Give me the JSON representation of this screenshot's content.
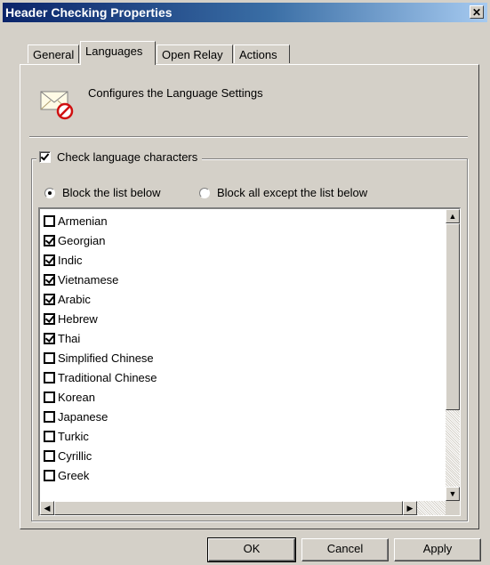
{
  "window": {
    "title": "Header Checking Properties",
    "close_glyph": "✕"
  },
  "tabs": [
    {
      "label": "General"
    },
    {
      "label": "Languages"
    },
    {
      "label": "Open Relay"
    },
    {
      "label": "Actions"
    }
  ],
  "active_tab": "Languages",
  "header": {
    "icon": "envelope-no-icon",
    "description": "Configures the Language Settings"
  },
  "check_language": {
    "label": "Check language characters",
    "checked": true
  },
  "mode": {
    "options": [
      {
        "label": "Block the list below",
        "selected": true
      },
      {
        "label": "Block all except the list below",
        "selected": false
      }
    ]
  },
  "languages": [
    {
      "label": "Armenian",
      "checked": false
    },
    {
      "label": "Georgian",
      "checked": true
    },
    {
      "label": "Indic",
      "checked": true
    },
    {
      "label": "Vietnamese",
      "checked": true
    },
    {
      "label": "Arabic",
      "checked": true
    },
    {
      "label": "Hebrew",
      "checked": true
    },
    {
      "label": "Thai",
      "checked": true
    },
    {
      "label": "Simplified Chinese",
      "checked": false
    },
    {
      "label": "Traditional Chinese",
      "checked": false
    },
    {
      "label": "Korean",
      "checked": false
    },
    {
      "label": "Japanese",
      "checked": false
    },
    {
      "label": "Turkic",
      "checked": false
    },
    {
      "label": "Cyrillic",
      "checked": false
    },
    {
      "label": "Greek",
      "checked": false
    }
  ],
  "buttons": {
    "ok": "OK",
    "cancel": "Cancel",
    "apply": "Apply"
  },
  "scroll_glyphs": {
    "up": "▲",
    "down": "▼",
    "left": "◀",
    "right": "▶"
  }
}
